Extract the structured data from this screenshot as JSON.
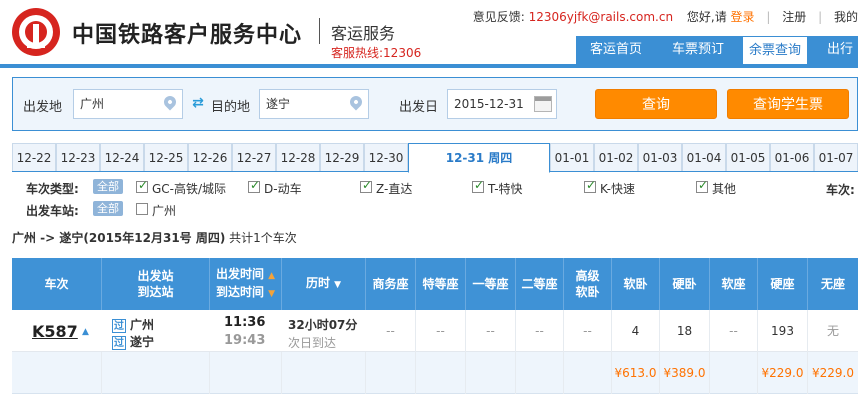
{
  "header": {
    "site_title": "中国铁路客户服务中心",
    "service_title": "客运服务",
    "hotline": "客服热线:12306",
    "feedback_label": "意见反馈:",
    "feedback_email": "12306yjfk@rails.com.cn",
    "greeting": "您好,请",
    "login": "登录",
    "separator": "|",
    "register": "注册",
    "extra": "我的"
  },
  "nav": {
    "items": [
      {
        "label": "客运首页"
      },
      {
        "label": "车票预订"
      },
      {
        "label": "余票查询"
      },
      {
        "label": "出行"
      }
    ],
    "active_index": 2
  },
  "search": {
    "from_label": "出发地",
    "from_value": "广州",
    "to_label": "目的地",
    "to_value": "遂宁",
    "date_label": "出发日",
    "date_value": "2015-12-31",
    "query_button": "查询",
    "student_button": "查询学生票"
  },
  "date_tabs": [
    "12-22",
    "12-23",
    "12-24",
    "12-25",
    "12-26",
    "12-27",
    "12-28",
    "12-29",
    "12-30",
    "12-31 周四",
    "01-01",
    "01-02",
    "01-03",
    "01-04",
    "01-05",
    "01-06",
    "01-07"
  ],
  "date_tabs_active_index": 9,
  "filters": {
    "type_label": "车次类型:",
    "all_tag": "全部",
    "types": [
      {
        "label": "GC-高铁/城际",
        "checked": true
      },
      {
        "label": "D-动车",
        "checked": true
      },
      {
        "label": "Z-直达",
        "checked": true
      },
      {
        "label": "T-特快",
        "checked": true
      },
      {
        "label": "K-快速",
        "checked": true
      },
      {
        "label": "其他",
        "checked": true
      }
    ],
    "station_label": "出发车站:",
    "stations": [
      {
        "label": "广州",
        "checked": false
      }
    ],
    "train_label": "车次:"
  },
  "route_summary": {
    "prefix": "广州 -> 遂宁(2015年12月31号 周四)",
    "count": "共计1个车次"
  },
  "table": {
    "headers": {
      "train": "车次",
      "station_1": "出发站",
      "station_2": "到达站",
      "time_1": "出发时间",
      "time_2": "到达时间",
      "duration": "历时",
      "business": "商务座",
      "special": "特等座",
      "first": "一等座",
      "second": "二等座",
      "high_1": "高级",
      "high_2": "软卧",
      "soft_sleeper": "软卧",
      "hard_sleeper": "硬卧",
      "soft_seat": "软座",
      "hard_seat": "硬座",
      "no_seat": "无座",
      "sort_up": "▲",
      "sort_down": "▼"
    },
    "rows": [
      {
        "train": "K587",
        "tag": "过",
        "from_station": "广州",
        "to_station": "遂宁",
        "depart": "11:36",
        "arrive": "19:43",
        "duration": "32小时07分",
        "arrive_note": "次日到达",
        "business": "--",
        "special": "--",
        "first": "--",
        "second": "--",
        "high_soft": "--",
        "soft_sleeper": "4",
        "hard_sleeper": "18",
        "soft_seat": "--",
        "hard_seat": "193",
        "no_seat": "无",
        "price_soft_sleeper": "¥613.0",
        "price_hard_sleeper": "¥389.0",
        "price_hard_seat": "¥229.0",
        "price_no_seat": "¥229.0"
      }
    ]
  }
}
